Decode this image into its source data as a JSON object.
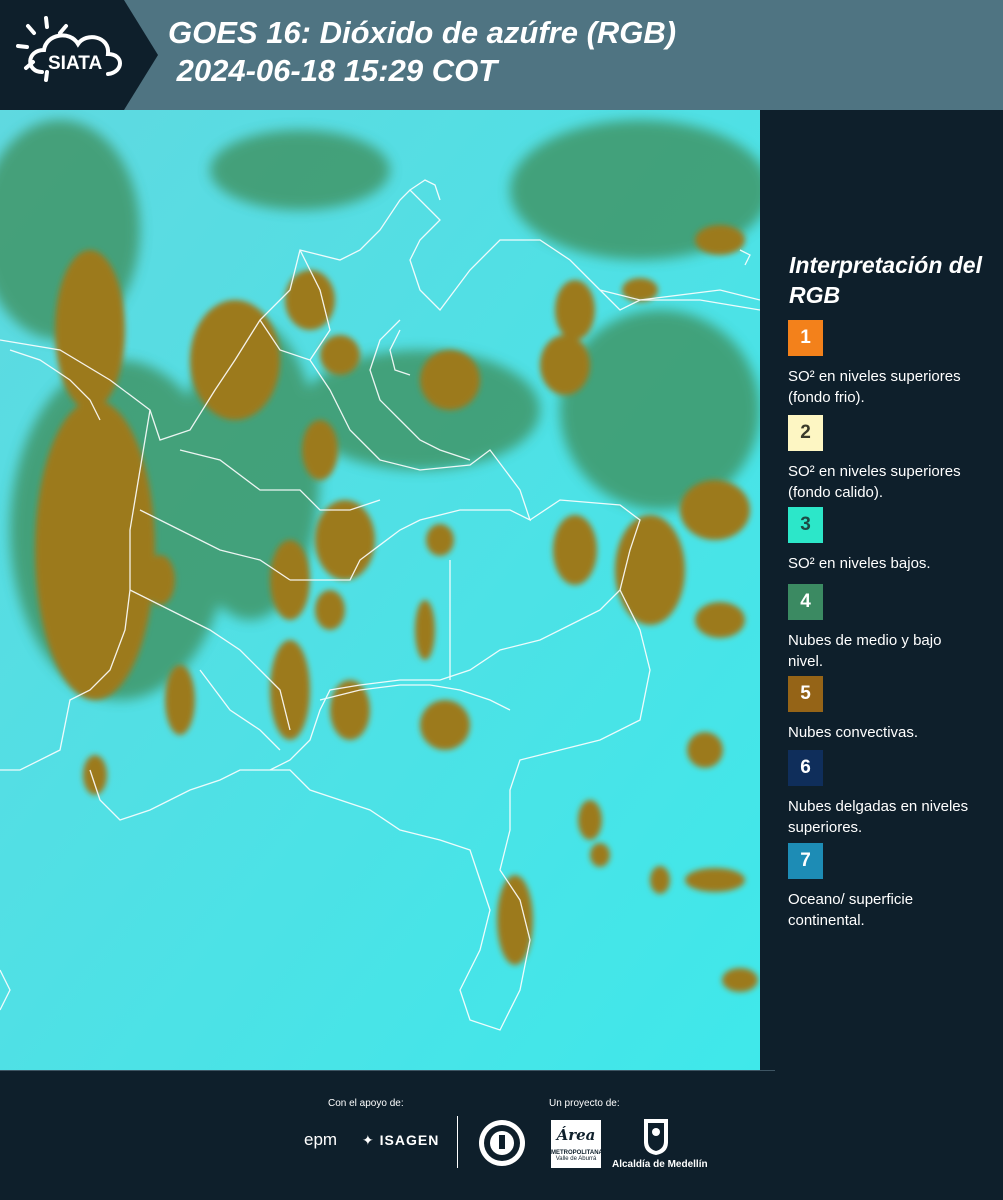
{
  "header": {
    "logo_text": "SIATA",
    "title_line1": "GOES 16: Dióxido de azúfre (RGB)",
    "title_line2": " 2024-06-18 15:29 COT"
  },
  "map": {
    "description_icon": "satellite-map",
    "colors": {
      "background": "#4fe0e4",
      "cloud": "#9c7a1e",
      "border": "#ffffff"
    }
  },
  "legend": {
    "title": "Interpretación del RGB",
    "items": [
      {
        "number": "1",
        "color": "#f3811b",
        "text_color": "#ffffff",
        "label": "SO² en niveles superiores (fondo frio)."
      },
      {
        "number": "2",
        "color": "#fdf6c3",
        "text_color": "#3a3a2a",
        "label": "SO² en niveles superiores (fondo calido)."
      },
      {
        "number": "3",
        "color": "#2ce7c9",
        "text_color": "#1d4a44",
        "label": "SO² en niveles bajos."
      },
      {
        "number": "4",
        "color": "#3b8a62",
        "text_color": "#ffffff",
        "label": "Nubes de medio y bajo nivel."
      },
      {
        "number": "5",
        "color": "#956417",
        "text_color": "#ffffff",
        "label": "Nubes convectivas."
      },
      {
        "number": "6",
        "color": "#0f2e5b",
        "text_color": "#ffffff",
        "label": "Nubes delgadas en niveles superiores."
      },
      {
        "number": "7",
        "color": "#1d8cb5",
        "text_color": "#ffffff",
        "label": "Oceano/ superficie continental."
      }
    ]
  },
  "footer": {
    "support_label": "Con el apoyo de:",
    "project_label": "Un proyecto de:",
    "sponsor_epm": "epm",
    "sponsor_isagen": "ISAGEN",
    "sponsor_area": "Área",
    "sponsor_area_sub1": "METROPOLITANA",
    "sponsor_area_sub2": "Valle de Aburrá",
    "sponsor_alcaldia": "Alcaldía de Medellín"
  }
}
